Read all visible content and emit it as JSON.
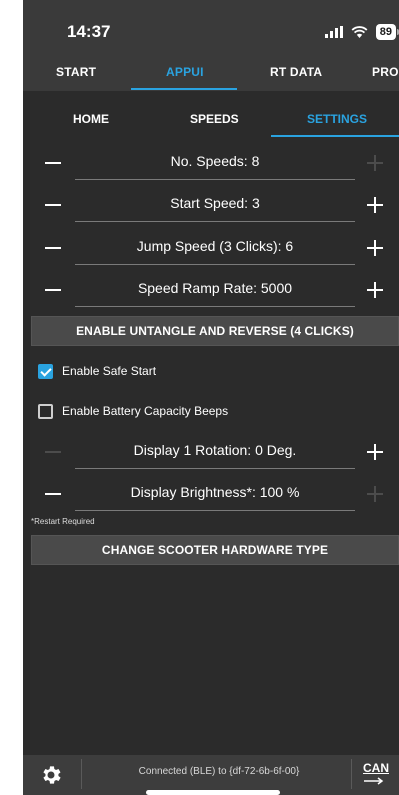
{
  "status_bar": {
    "time": "14:37",
    "battery": "89"
  },
  "top_tabs": [
    {
      "label": "START",
      "active": false
    },
    {
      "label": "APPUI",
      "active": true
    },
    {
      "label": "RT DATA",
      "active": false
    },
    {
      "label": "PRO",
      "active": false
    }
  ],
  "sub_tabs": [
    {
      "label": "HOME",
      "active": false
    },
    {
      "label": "SPEEDS",
      "active": false
    },
    {
      "label": "SETTINGS",
      "active": true
    }
  ],
  "settings": {
    "no_speeds": "No. Speeds: 8",
    "start_speed": "Start Speed: 3",
    "jump_speed": "Jump Speed (3 Clicks): 6",
    "ramp_rate": "Speed Ramp Rate: 5000",
    "untangle_button": "ENABLE UNTANGLE AND REVERSE (4 CLICKS)",
    "safe_start": {
      "label": "Enable Safe Start",
      "checked": true
    },
    "battery_beeps": {
      "label": "Enable Battery Capacity Beeps",
      "checked": false
    },
    "rotation": "Display 1 Rotation: 0 Deg.",
    "brightness": "Display Brightness*: 100 %",
    "restart_note": "*Restart Required",
    "hardware_button": "CHANGE SCOOTER HARDWARE TYPE"
  },
  "bottom_bar": {
    "connection": "Connected (BLE) to {df-72-6b-6f-00}",
    "can_label": "CAN"
  },
  "colors": {
    "accent": "#2aa3e0",
    "background": "#2b2b2b",
    "bar": "#3a3a3a"
  }
}
